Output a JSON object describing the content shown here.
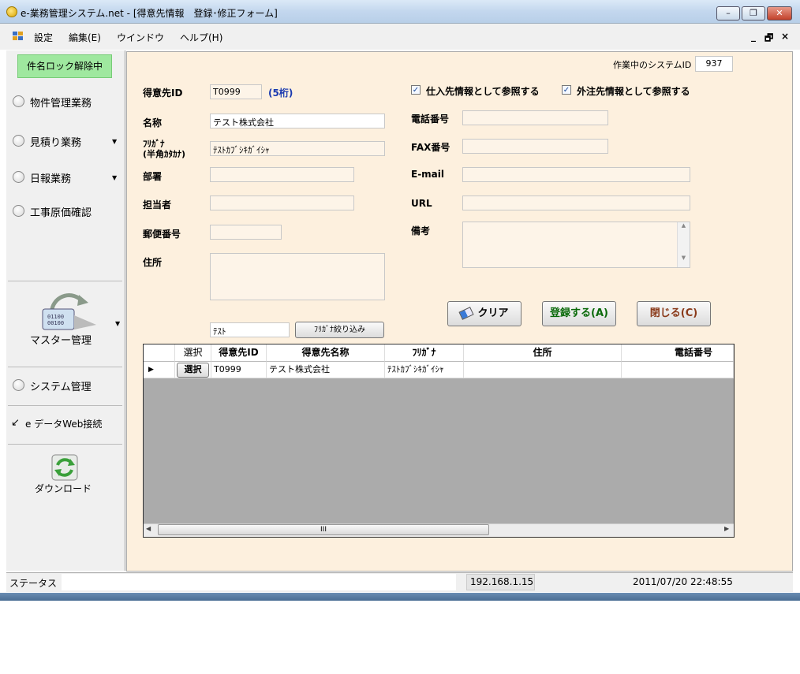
{
  "window": {
    "title": "e-業務管理システム.net - [得意先情報　登録･修正フォーム]",
    "min_label": "–",
    "restore_label": "❐",
    "close_label": "✕"
  },
  "menu": {
    "items": [
      "設定",
      "編集(E)",
      "ウインドウ",
      "ヘルプ(H)"
    ],
    "mdi_min": "_",
    "mdi_restore": "🗗",
    "mdi_close": "×"
  },
  "sidebar": {
    "lock_badge": "件名ロック解除中",
    "items": [
      "物件管理業務",
      "見積り業務",
      "日報業務",
      "工事原価確認"
    ],
    "master_label": "マスター管理",
    "system_label": "システム管理",
    "edata_label": "e データWeb接続",
    "download_label": "ダウンロード"
  },
  "form": {
    "system_id_label": "作業中のシステムID",
    "system_id_value": "937",
    "customer_id_label": "得意先ID",
    "customer_id_value": "T0999",
    "customer_id_hint": "(5桁)",
    "name_label": "名称",
    "name_value": "テスト株式会社",
    "furigana_label_1": "ﾌﾘｶﾞﾅ",
    "furigana_label_2": "(半角ｶﾀｶﾅ)",
    "furigana_value": "ﾃｽﾄｶﾌﾞｼｷｶﾞｲｼｬ",
    "dept_label": "部署",
    "person_label": "担当者",
    "postal_label": "郵便番号",
    "address_label": "住所",
    "check_supplier": "仕入先情報として参照する",
    "check_outsource": "外注先情報として参照する",
    "phone_label": "電話番号",
    "fax_label": "FAX番号",
    "email_label": "E-mail",
    "url_label": "URL",
    "note_label": "備考",
    "clear_btn": "クリア",
    "register_btn": "登録する(A)",
    "close_btn": "閉じる(C)",
    "filter_value": "ﾃｽﾄ",
    "filter_btn": "ﾌﾘｶﾞﾅ絞り込み"
  },
  "grid": {
    "columns": [
      "選択",
      "得意先ID",
      "得意先名称",
      "ﾌﾘｶﾞﾅ",
      "住所",
      "電話番号"
    ],
    "rows": [
      {
        "select": "選択",
        "id": "T0999",
        "name": "テスト株式会社",
        "kana": "ﾃｽﾄｶﾌﾞｼｷｶﾞｲｼｬ",
        "address": "",
        "phone": ""
      }
    ],
    "scroll_grip": "III"
  },
  "status": {
    "label": "ステータス",
    "ip": "192.168.1.15",
    "datetime": "2011/07/20 22:48:55"
  }
}
